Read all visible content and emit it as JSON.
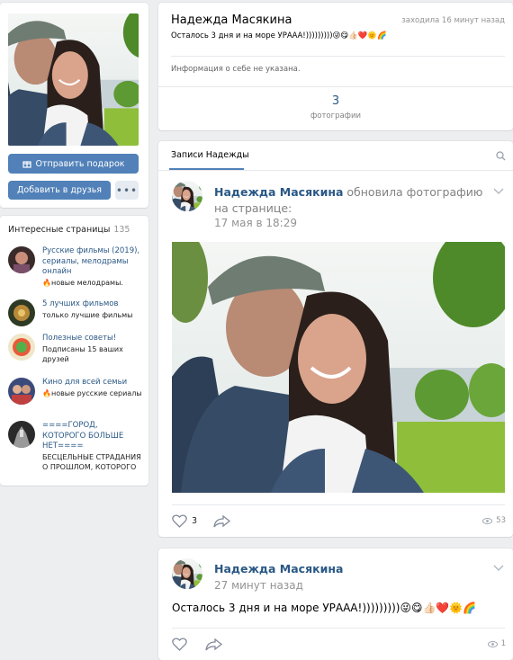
{
  "profile": {
    "name": "Надежда Масякина",
    "last_seen": "заходила 16 минут назад",
    "status": "Осталось 3 дня и на море УРААА!)))))))))😜😋👍🏻❤️🌞🌈",
    "no_info": "Информация о себе не указана.",
    "photos_count": "3",
    "photos_label": "фотографии"
  },
  "sidebar": {
    "gift_button": "Отправить подарок",
    "add_friend_button": "Добавить в друзья",
    "more_button": "•••",
    "pages_title": "Интересные страницы",
    "pages_count": "135",
    "pages": [
      {
        "name": "Русские фильмы (2019), сериалы, мелодрамы онлайн",
        "sub": "🔥новые мелодрамы."
      },
      {
        "name": "5 лучших фильмов",
        "sub": "только лучшие фильмы"
      },
      {
        "name": "Полезные советы!",
        "sub": "Подписаны 15 ваших друзей"
      },
      {
        "name": "Кино для всей семьи",
        "sub": "🔥новые русские сериалы"
      },
      {
        "name": "====ГОРОД, КОТОРОГО БОЛЬШЕ НЕТ====",
        "sub": "БЕСЦЕЛЬНЫЕ СТРАДАНИЯ О ПРОШЛОМ, КОТОРОГО"
      }
    ]
  },
  "wall": {
    "tab": "Записи Надежды",
    "icons": {
      "search": "search-icon",
      "chevron": "chevron-down-icon",
      "like": "heart-icon",
      "share": "share-icon",
      "views": "eye-icon"
    },
    "post1": {
      "author": "Надежда Масякина",
      "action": " обновила фотографию на странице:",
      "time": "17 мая в 18:29",
      "likes": "3",
      "views": "53"
    },
    "post2": {
      "author": "Надежда Масякина",
      "time": "27 минут назад",
      "text": "Осталось 3 дня и на море УРААА!)))))))))😜😋👍🏻❤️🌞🌈",
      "views": "1"
    }
  },
  "colors": {
    "accent": "#5181b8",
    "link": "#2a5885",
    "background": "#edeef0"
  }
}
